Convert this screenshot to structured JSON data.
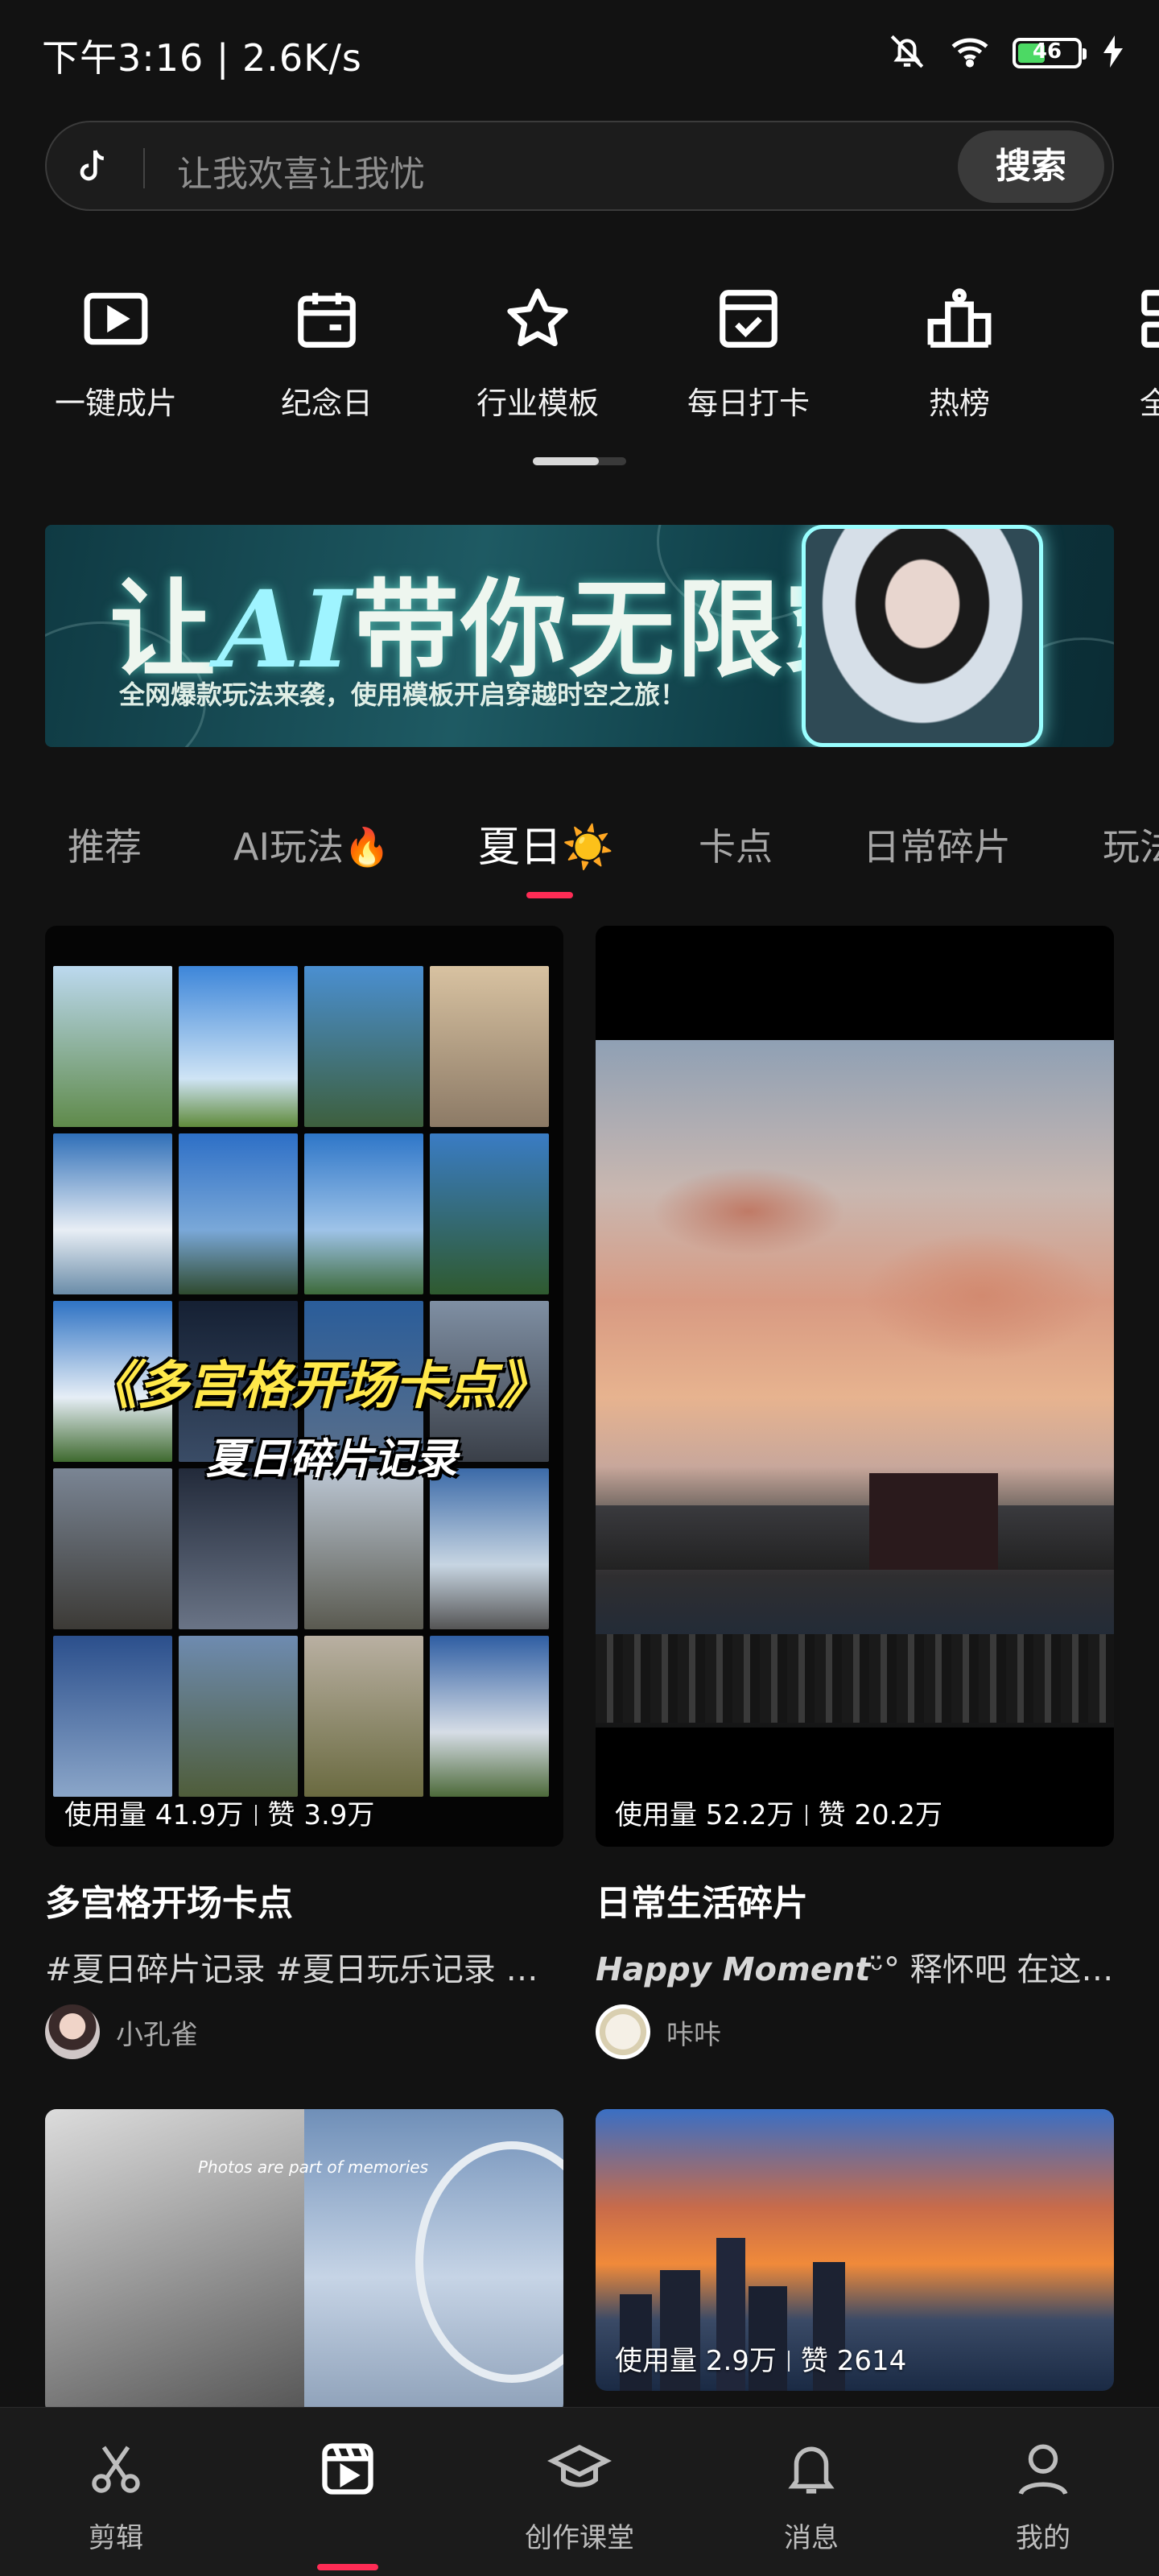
{
  "status_bar": {
    "time_speed": "下午3:16 | 2.6K/s",
    "battery": "46"
  },
  "search": {
    "placeholder": "让我欢喜让我忧",
    "button": "搜索"
  },
  "quick_actions": [
    {
      "label": "一键成片",
      "icon": "play-square-icon"
    },
    {
      "label": "纪念日",
      "icon": "calendar-icon"
    },
    {
      "label": "行业模板",
      "icon": "star-icon"
    },
    {
      "label": "每日打卡",
      "icon": "checkin-icon"
    },
    {
      "label": "热榜",
      "icon": "podium-icon"
    },
    {
      "label": "全部",
      "icon": "grid-icon"
    }
  ],
  "banner": {
    "title_prefix": "让",
    "title_ai": "AI",
    "title_suffix": "带你无限穿越",
    "subtitle": "全网爆款玩法来袭，使用模板开启穿越时空之旅！"
  },
  "tabs": [
    "推荐",
    "AI玩法🔥",
    "夏日☀️",
    "卡点",
    "日常碎片",
    "玩法"
  ],
  "active_tab": "夏日☀️",
  "cards": [
    {
      "title": "多宫格开场卡点",
      "desc": "#夏日碎片记录 #夏日玩乐记录 #夏日",
      "usage": "使用量 41.9万",
      "likes": "赞 3.9万",
      "author": "小孔雀",
      "overlay_title": "《多宫格开场卡点》",
      "overlay_sub": "夏日碎片记录"
    },
    {
      "title": "日常生活碎片",
      "desc_em": "Happy Moment",
      "desc": "ᵕ̈° 释怀吧 在这个世界上",
      "usage": "使用量 52.2万",
      "likes": "赞 20.2万",
      "author": "咔咔"
    },
    {
      "overlay_text": "Photos are part of memories"
    },
    {
      "usage": "使用量 2.9万",
      "likes": "赞 2614"
    }
  ],
  "bottom_nav": [
    {
      "label": "剪辑",
      "icon": "scissors-icon"
    },
    {
      "label": "",
      "icon": "template-icon"
    },
    {
      "label": "创作课堂",
      "icon": "graduation-cap-icon"
    },
    {
      "label": "消息",
      "icon": "bell-icon"
    },
    {
      "label": "我的",
      "icon": "profile-icon"
    }
  ],
  "colors": {
    "accent": "#fe2c55",
    "background": "#121212"
  }
}
